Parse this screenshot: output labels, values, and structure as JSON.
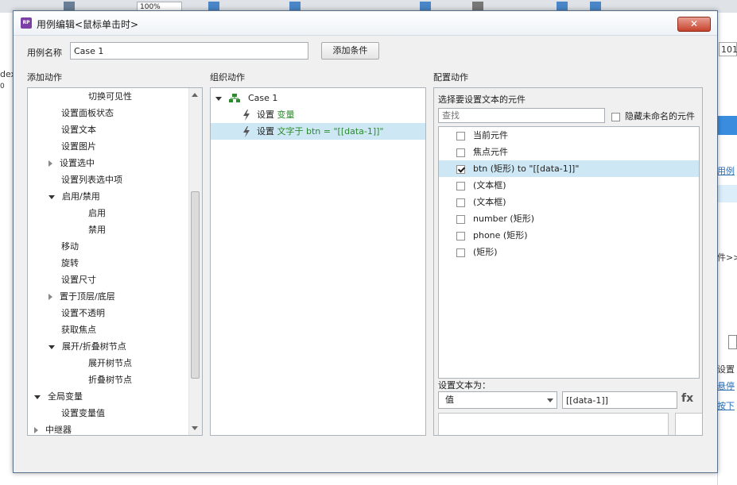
{
  "background": {
    "zoom": "100%",
    "left_fragment_1": "dex",
    "left_fragment_2": "0",
    "right_fragment_1": "101",
    "right_fragment_2": "用例",
    "right_fragment_3": "件>>",
    "right_fragment_4": "设置",
    "right_fragment_5": "悬停",
    "right_fragment_6": "按下"
  },
  "dialog": {
    "title": "用例编辑<鼠标单击时>",
    "close": "✕",
    "case_name_label": "用例名称",
    "case_name_value": "Case 1",
    "add_condition": "添加条件"
  },
  "add_actions": {
    "header": "添加动作",
    "items": [
      {
        "label": "切换可见性",
        "level": 3,
        "toggle": "none"
      },
      {
        "label": "设置面板状态",
        "level": 2,
        "toggle": "none"
      },
      {
        "label": "设置文本",
        "level": 2,
        "toggle": "none"
      },
      {
        "label": "设置图片",
        "level": 2,
        "toggle": "none"
      },
      {
        "label": "设置选中",
        "level": 2,
        "toggle": "collapsed"
      },
      {
        "label": "设置列表选中项",
        "level": 2,
        "toggle": "none"
      },
      {
        "label": "启用/禁用",
        "level": 2,
        "toggle": "expanded"
      },
      {
        "label": "启用",
        "level": 3,
        "toggle": "none"
      },
      {
        "label": "禁用",
        "level": 3,
        "toggle": "none"
      },
      {
        "label": "移动",
        "level": 2,
        "toggle": "none"
      },
      {
        "label": "旋转",
        "level": 2,
        "toggle": "none"
      },
      {
        "label": "设置尺寸",
        "level": 2,
        "toggle": "none"
      },
      {
        "label": "置于顶层/底层",
        "level": 2,
        "toggle": "collapsed"
      },
      {
        "label": "设置不透明",
        "level": 2,
        "toggle": "none"
      },
      {
        "label": "获取焦点",
        "level": 2,
        "toggle": "none"
      },
      {
        "label": "展开/折叠树节点",
        "level": 2,
        "toggle": "expanded"
      },
      {
        "label": "展开树节点",
        "level": 3,
        "toggle": "none"
      },
      {
        "label": "折叠树节点",
        "level": 3,
        "toggle": "none"
      },
      {
        "label": "全局变量",
        "level": 1,
        "toggle": "expanded"
      },
      {
        "label": "设置变量值",
        "level": 2,
        "toggle": "none"
      },
      {
        "label": "中继器",
        "level": 1,
        "toggle": "collapsed"
      }
    ]
  },
  "organize": {
    "header": "组织动作",
    "case_label": "Case 1",
    "actions": [
      {
        "prefix": "设置",
        "detail": "变量"
      },
      {
        "prefix": "设置",
        "detail": "文字于 btn = \"[[data-1]]\""
      }
    ]
  },
  "configure": {
    "header": "配置动作",
    "subheader": "选择要设置文本的元件",
    "search_placeholder": "查找",
    "hide_unnamed": "隐藏未命名的元件",
    "widgets": [
      {
        "label": "当前元件",
        "checked": false
      },
      {
        "label": "焦点元件",
        "checked": false
      },
      {
        "label": "btn (矩形) to \"[[data-1]]\"",
        "checked": true
      },
      {
        "label": "(文本框)",
        "checked": false
      },
      {
        "label": "(文本框)",
        "checked": false
      },
      {
        "label": "number (矩形)",
        "checked": false
      },
      {
        "label": "phone (矩形)",
        "checked": false
      },
      {
        "label": "(矩形)",
        "checked": false
      }
    ],
    "set_text_label": "设置文本为：",
    "value_type": "值",
    "value": "[[data-1]]",
    "fx": "fx"
  },
  "colors": {
    "selection": "#cde8f4",
    "accent": "#2d8a2d"
  }
}
